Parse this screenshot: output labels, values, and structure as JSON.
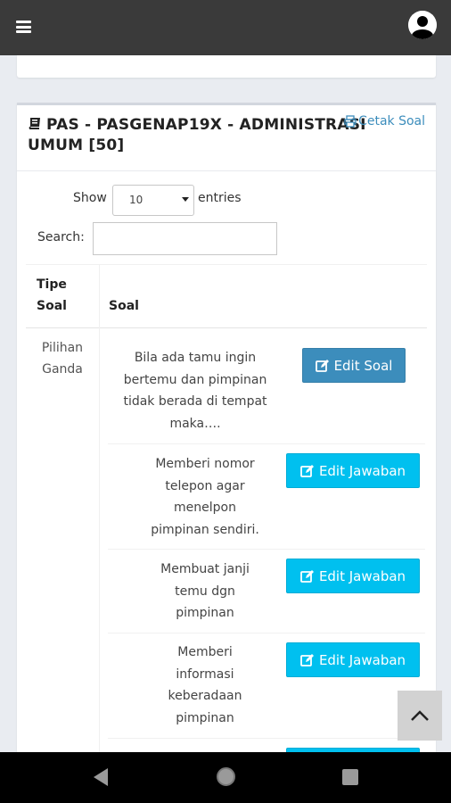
{
  "header": {
    "menu_icon": "hamburger-icon",
    "user_icon": "user-avatar-icon"
  },
  "card": {
    "title": "PAS - PASGENAP19X - ADMINISTRASI UMUM [50]",
    "title_icon": "book-icon",
    "cetak_label": "Cetak Soal",
    "cetak_icon": "print-icon"
  },
  "controls": {
    "show_label": "Show",
    "entries_value": "10",
    "entries_label": "entries",
    "search_label": "Search:",
    "search_value": ""
  },
  "table": {
    "columns": [
      "Tipe Soal",
      "Soal"
    ],
    "tipe_soal": "Pilihan Ganda",
    "rows": [
      {
        "text": "Bila ada tamu ingin bertemu dan pimpinan tidak berada di tempat maka….",
        "button": "Edit Soal",
        "kind": "soal"
      },
      {
        "text": "Memberi nomor telepon agar menelpon pimpinan sendiri.",
        "button": "Edit Jawaban",
        "kind": "jawaban"
      },
      {
        "text": "Membuat janji temu dgn pimpinan",
        "button": "Edit Jawaban",
        "kind": "jawaban"
      },
      {
        "text": "Memberi informasi keberadaan pimpinan",
        "button": "Edit Jawaban",
        "kind": "jawaban"
      }
    ]
  },
  "colors": {
    "topbar": "#3a3a3a",
    "primary": "#3c8dbc",
    "info": "#00c0ef",
    "background": "#e9ecf1"
  },
  "system_nav": {
    "back_icon": "back-triangle-icon",
    "home_icon": "home-circle-icon",
    "recent_icon": "recent-apps-icon"
  },
  "scroll_top_icon": "chevron-up-icon"
}
